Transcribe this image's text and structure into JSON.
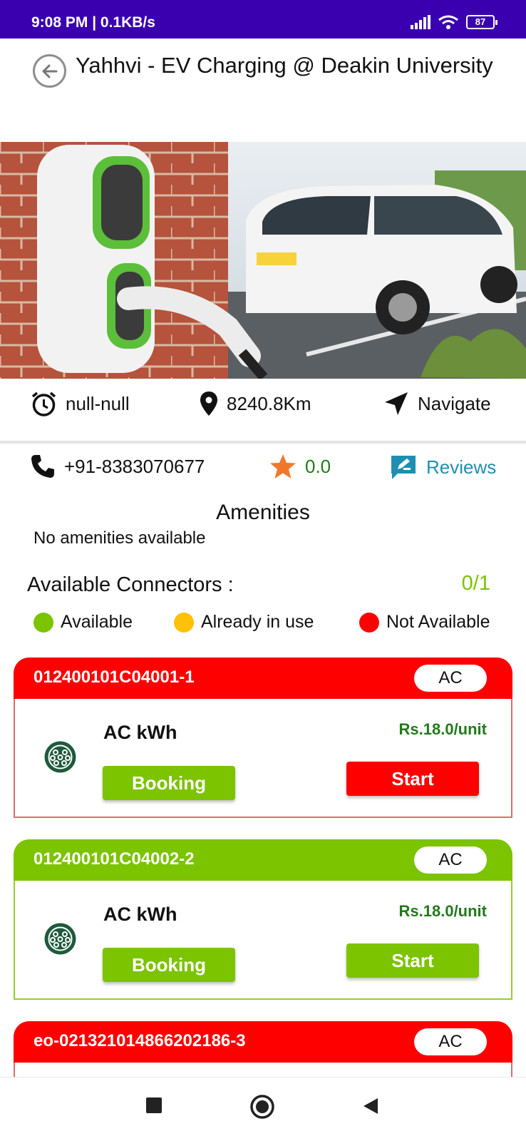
{
  "status": {
    "time": "9:08 PM | 0.1KB/s",
    "battery": "87"
  },
  "header": {
    "title": "Yahhvi - EV Charging @ Deakin University"
  },
  "info": {
    "hours": "null-null",
    "distance": "8240.8Km",
    "navigate": "Navigate"
  },
  "contact": {
    "phone": "+91-8383070677",
    "rating": "0.0",
    "reviews": "Reviews"
  },
  "amenities": {
    "title": "Amenities",
    "text": "No amenities available"
  },
  "connectors": {
    "title": "Available Connectors :",
    "count": "0/1",
    "legend": {
      "available": "Available",
      "in_use": "Already in use",
      "not_available": "Not Available"
    },
    "items": [
      {
        "id": "012400101C04001-1",
        "type": "AC",
        "label": "AC kWh",
        "price": "Rs.18.0/unit",
        "booking": "Booking",
        "start": "Start",
        "status_color": "#ff0000"
      },
      {
        "id": "012400101C04002-2",
        "type": "AC",
        "label": "AC kWh",
        "price": "Rs.18.0/unit",
        "booking": "Booking",
        "start": "Start",
        "status_color": "#7cc300"
      },
      {
        "id": "eo-021321014866202186-3",
        "type": "AC"
      }
    ]
  },
  "colors": {
    "status_bar": "#3a00b0",
    "available": "#7cc300",
    "in_use": "#ffc107",
    "not_available": "#ff0000",
    "accent_blue": "#1e8fb3",
    "star": "#f0782d"
  }
}
